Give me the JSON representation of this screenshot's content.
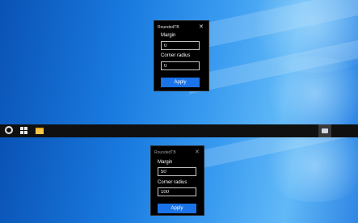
{
  "top_dialog": {
    "title": "RoundedTB",
    "close_glyph": "✕",
    "margin_label": "Margin",
    "margin_value": "0",
    "corner_label": "Corner radius",
    "corner_value": "0",
    "apply_label": "Apply"
  },
  "bottom_dialog": {
    "title": "RoundedTB",
    "close_glyph": "✕",
    "margin_label": "Margin",
    "margin_value": "50",
    "corner_label": "Corner radius",
    "corner_value": "100",
    "apply_label": "Apply"
  },
  "taskbar": {
    "icons": [
      "search-icon",
      "task-view-icon",
      "file-explorer-icon",
      "tray-app-icon"
    ]
  },
  "colors": {
    "accent": "#1a73e8",
    "taskbar": "#101010",
    "dialog_bg": "#000000"
  }
}
